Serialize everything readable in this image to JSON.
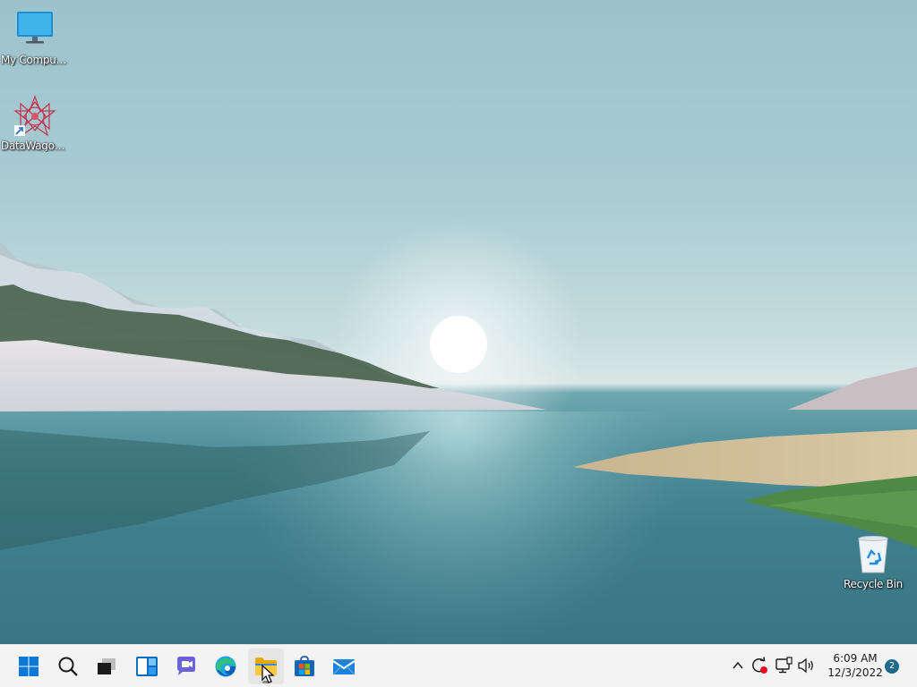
{
  "desktop": {
    "icons": [
      {
        "label": "My Computer",
        "icon": "monitor-icon"
      },
      {
        "label": "DataWagon...",
        "icon": "datawagon-star-icon"
      },
      {
        "label": "Recycle Bin",
        "icon": "recycle-bin-icon"
      }
    ]
  },
  "taskbar": {
    "apps": [
      {
        "name": "Start",
        "icon": "windows-start-icon"
      },
      {
        "name": "Search",
        "icon": "search-icon"
      },
      {
        "name": "Task View",
        "icon": "task-view-icon"
      },
      {
        "name": "Widgets",
        "icon": "widgets-icon"
      },
      {
        "name": "Chat",
        "icon": "teams-chat-icon"
      },
      {
        "name": "Microsoft Edge",
        "icon": "edge-icon"
      },
      {
        "name": "File Explorer",
        "icon": "folder-icon",
        "active": true
      },
      {
        "name": "Microsoft Store",
        "icon": "store-icon"
      },
      {
        "name": "Mail",
        "icon": "mail-icon"
      }
    ],
    "tray": {
      "icons": [
        "chevron-up-icon",
        "sync-icon",
        "network-icon",
        "volume-icon"
      ],
      "time": "6:09 AM",
      "date": "12/3/2022",
      "notification_count": "2"
    }
  },
  "colors": {
    "taskbar_bg": "#f3f3f3",
    "accent": "#0078d4"
  }
}
